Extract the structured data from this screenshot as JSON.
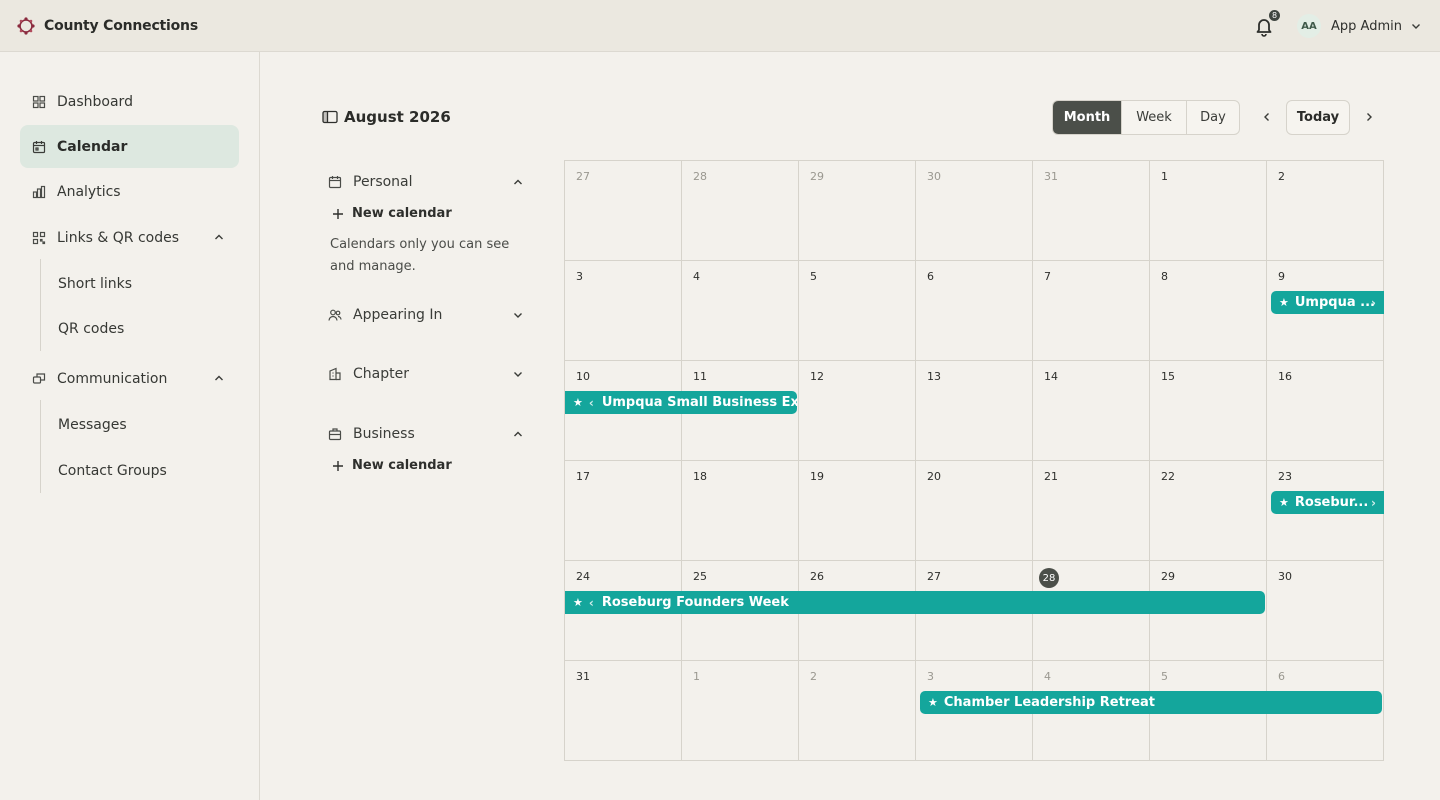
{
  "app": {
    "brand": "County Connections",
    "accent": "#14a69c"
  },
  "header": {
    "notification_count": "8",
    "avatar_initials": "AA",
    "user_name": "App Admin"
  },
  "sidebar": {
    "items": [
      {
        "label": "Dashboard",
        "icon": "dashboard-icon"
      },
      {
        "label": "Calendar",
        "icon": "calendar-icon",
        "active": true
      },
      {
        "label": "Analytics",
        "icon": "chart-icon"
      },
      {
        "label": "Links & QR codes",
        "icon": "qr-icon",
        "expanded": true
      },
      {
        "label": "Short links"
      },
      {
        "label": "QR codes"
      },
      {
        "label": "Communication",
        "icon": "chat-icon",
        "expanded": true
      },
      {
        "label": "Messages"
      },
      {
        "label": "Contact Groups"
      }
    ]
  },
  "calendar": {
    "title": "August 2026",
    "views": [
      "Month",
      "Week",
      "Day"
    ],
    "active_view": "Month",
    "today_label": "Today",
    "groups": [
      {
        "label": "Personal",
        "expanded": true,
        "new_label": "New calendar",
        "description": "Calendars only you can see and manage."
      },
      {
        "label": "Appearing In",
        "expanded": false
      },
      {
        "label": "Chapter",
        "expanded": false
      },
      {
        "label": "Business",
        "expanded": true,
        "new_label": "New calendar"
      }
    ],
    "weeks": [
      [
        "27",
        "28",
        "29",
        "30",
        "31",
        "1",
        "2"
      ],
      [
        "3",
        "4",
        "5",
        "6",
        "7",
        "8",
        "9"
      ],
      [
        "10",
        "11",
        "12",
        "13",
        "14",
        "15",
        "16"
      ],
      [
        "17",
        "18",
        "19",
        "20",
        "21",
        "22",
        "23"
      ],
      [
        "24",
        "25",
        "26",
        "27",
        "28",
        "29",
        "30"
      ],
      [
        "31",
        "1",
        "2",
        "3",
        "4",
        "5",
        "6"
      ]
    ],
    "today": {
      "week": 4,
      "day": 4
    },
    "events": [
      {
        "title": "Umpqua ...",
        "week": 1,
        "start": 6,
        "end": 6,
        "continues_before": false,
        "continues_after": true
      },
      {
        "title": "Umpqua Small Business Expo",
        "week": 2,
        "start": 0,
        "end": 1,
        "continues_before": true,
        "continues_after": false
      },
      {
        "title": "Rosebur...",
        "week": 3,
        "start": 6,
        "end": 6,
        "continues_before": false,
        "continues_after": true
      },
      {
        "title": "Roseburg Founders Week",
        "week": 4,
        "start": 0,
        "end": 5,
        "continues_before": true,
        "continues_after": false
      },
      {
        "title": "Chamber Leadership Retreat",
        "week": 5,
        "start": 3,
        "end": 6,
        "continues_before": false,
        "continues_after": false
      }
    ]
  }
}
